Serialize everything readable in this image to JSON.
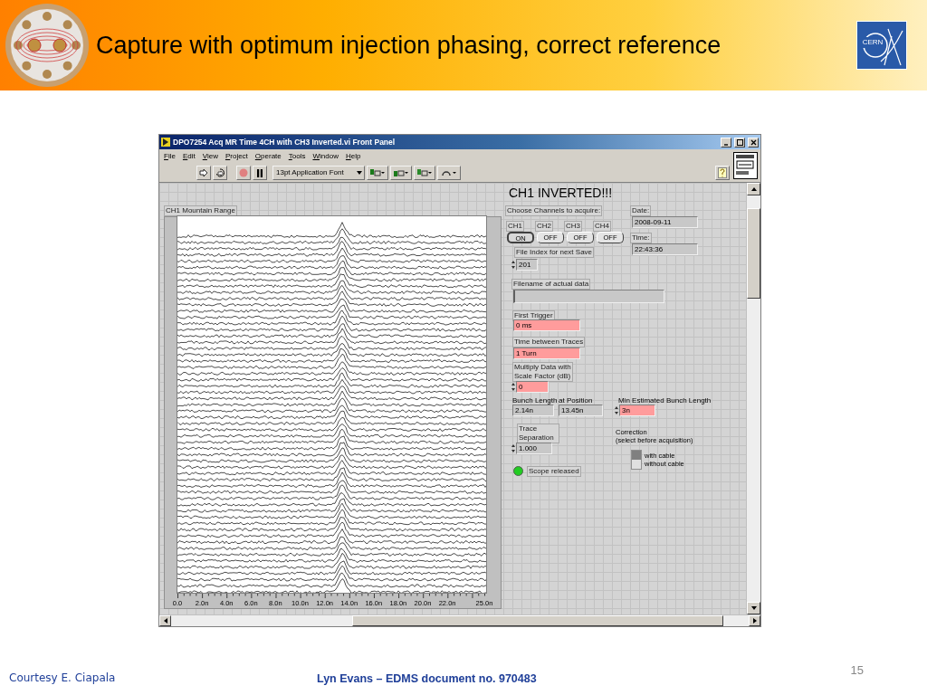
{
  "slide": {
    "title": "Capture with optimum injection phasing, correct reference",
    "logo_text": "CERN",
    "footer_left": "Courtesy E. Ciapala",
    "footer_center": "Lyn Evans – EDMS document no. 970483",
    "page_number": "15"
  },
  "window": {
    "title": "DPO7254 Acq MR Time 4CH with CH3 Inverted.vi Front Panel",
    "menu": [
      "File",
      "Edit",
      "View",
      "Project",
      "Operate",
      "Tools",
      "Window",
      "Help"
    ],
    "font_menu": "13pt Application Font"
  },
  "panel": {
    "heading": "CH1 INVERTED!!!",
    "graph": {
      "label": "CH1 Mountain Range",
      "x_ticks": [
        "0.0",
        "2.0n",
        "4.0n",
        "6.0n",
        "8.0n",
        "10.0n",
        "12.0n",
        "14.0n",
        "16.0n",
        "18.0n",
        "20.0n",
        "22.0n",
        "25.0n"
      ]
    },
    "channels": {
      "label": "Choose Channels to acquire:",
      "items": [
        {
          "label": "CH1",
          "button": "ON",
          "on": true
        },
        {
          "label": "CH2",
          "button": "OFF",
          "on": false
        },
        {
          "label": "CH3",
          "button": "OFF",
          "on": false
        },
        {
          "label": "CH4",
          "button": "OFF",
          "on": false
        }
      ]
    },
    "date": {
      "label": "Date:",
      "value": "2008-09-11"
    },
    "time": {
      "label": "Time:",
      "value": "22:43:36"
    },
    "file_index": {
      "label": "File Index for next Save",
      "value": "201"
    },
    "filename": {
      "label": "Filename of actual data"
    },
    "first_trigger": {
      "label": "First Trigger",
      "value": "0 ms"
    },
    "time_between": {
      "label": "Time between Traces",
      "value": "1 Turn"
    },
    "scale": {
      "label_lines": [
        "Multiply Data with",
        "Scale Factor (dB)"
      ],
      "value": "0"
    },
    "bunch_length": {
      "label": "Bunch Length",
      "value": "2.14n"
    },
    "position": {
      "label": "at Position",
      "value": "13.45n"
    },
    "min_bunch": {
      "label": "Min Estimated Bunch Length",
      "value": "3n"
    },
    "trace_sep": {
      "label_lines": [
        "Trace",
        "Separation"
      ],
      "value": "1.000"
    },
    "correction": {
      "label_lines": [
        "Correction",
        "(select before acquisition)"
      ],
      "options": [
        {
          "label": "with cable",
          "selected": true
        },
        {
          "label": "without cable",
          "selected": false
        }
      ]
    },
    "scope": {
      "label": "Scope released",
      "on": true
    }
  }
}
